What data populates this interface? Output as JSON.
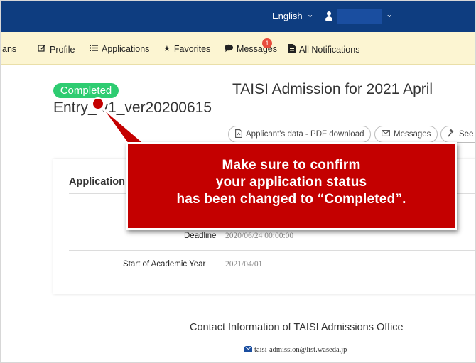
{
  "topbar": {
    "language": "English",
    "language_chevron": "⌄",
    "user_chevron": "⌄"
  },
  "nav": {
    "items": [
      {
        "label": "ans",
        "icon": ""
      },
      {
        "label": "Profile",
        "icon": "edit-icon"
      },
      {
        "label": "Applications",
        "icon": "list-icon"
      },
      {
        "label": "Favorites",
        "icon": "star-icon"
      },
      {
        "label": "Messages",
        "icon": "chat-icon",
        "badge": "1"
      },
      {
        "label": "All Notifications",
        "icon": "document-icon"
      }
    ]
  },
  "header": {
    "status": "Completed",
    "title_line1": "TAISI Admission for 2021 April",
    "title_line2": "Entry_  v1_ver20200615"
  },
  "actions": {
    "pdf_label": "Applicant's data - PDF download",
    "messages_label": "Messages",
    "see_label": "See"
  },
  "card": {
    "title": "Application I",
    "rows": [
      {
        "label": "Deadline",
        "value": "2020/06/24 00:00:00"
      },
      {
        "label": "Start of Academic Year",
        "value": "2021/04/01"
      }
    ]
  },
  "contact": {
    "title": "Contact Information of TAISI Admissions Office",
    "email": "taisi-admission@list.waseda.jp"
  },
  "annotation": {
    "line1": "Make sure to confirm",
    "line2": "your application status",
    "line3": "has been changed to “Completed”."
  },
  "colors": {
    "topbar": "#0e3d80",
    "navbar": "#fcf5d2",
    "status_green": "#2ecc71",
    "callout_red": "#c40000",
    "badge_red": "#e74c3c"
  }
}
